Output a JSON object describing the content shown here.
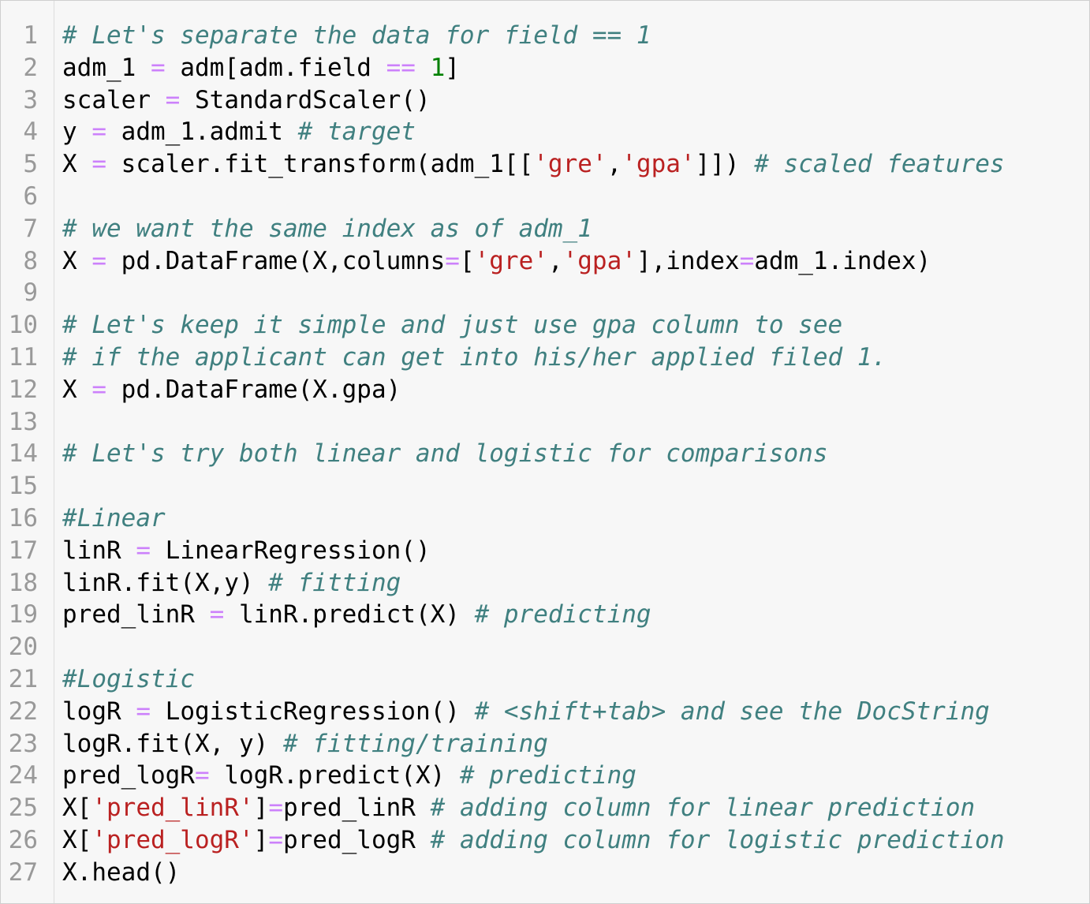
{
  "colors": {
    "background": "#f7f7f7",
    "line_number": "#999999",
    "comment": "#408080",
    "string": "#ba2121",
    "number": "#008000",
    "operator": "#aa22ff",
    "text": "#000000"
  },
  "lines": [
    {
      "n": "1",
      "tokens": [
        {
          "t": "# Let's separate the data for field == 1",
          "k": "comment"
        }
      ]
    },
    {
      "n": "2",
      "tokens": [
        {
          "t": "adm_1 ",
          "k": "text"
        },
        {
          "t": "=",
          "k": "op"
        },
        {
          "t": " adm[adm.field ",
          "k": "text"
        },
        {
          "t": "==",
          "k": "op"
        },
        {
          "t": " ",
          "k": "text"
        },
        {
          "t": "1",
          "k": "number"
        },
        {
          "t": "]",
          "k": "text"
        }
      ]
    },
    {
      "n": "3",
      "tokens": [
        {
          "t": "scaler ",
          "k": "text"
        },
        {
          "t": "=",
          "k": "op"
        },
        {
          "t": " StandardScaler()",
          "k": "text"
        }
      ]
    },
    {
      "n": "4",
      "tokens": [
        {
          "t": "y ",
          "k": "text"
        },
        {
          "t": "=",
          "k": "op"
        },
        {
          "t": " adm_1.admit ",
          "k": "text"
        },
        {
          "t": "# target",
          "k": "comment"
        }
      ]
    },
    {
      "n": "5",
      "tokens": [
        {
          "t": "X ",
          "k": "text"
        },
        {
          "t": "=",
          "k": "op"
        },
        {
          "t": " scaler.fit_transform(adm_1[[",
          "k": "text"
        },
        {
          "t": "'gre'",
          "k": "string"
        },
        {
          "t": ",",
          "k": "text"
        },
        {
          "t": "'gpa'",
          "k": "string"
        },
        {
          "t": "]]) ",
          "k": "text"
        },
        {
          "t": "# scaled features",
          "k": "comment"
        }
      ]
    },
    {
      "n": "6",
      "tokens": []
    },
    {
      "n": "7",
      "tokens": [
        {
          "t": "# we want the same index as of adm_1",
          "k": "comment"
        }
      ]
    },
    {
      "n": "8",
      "tokens": [
        {
          "t": "X ",
          "k": "text"
        },
        {
          "t": "=",
          "k": "op"
        },
        {
          "t": " pd.DataFrame(X,columns",
          "k": "text"
        },
        {
          "t": "=",
          "k": "op"
        },
        {
          "t": "[",
          "k": "text"
        },
        {
          "t": "'gre'",
          "k": "string"
        },
        {
          "t": ",",
          "k": "text"
        },
        {
          "t": "'gpa'",
          "k": "string"
        },
        {
          "t": "],index",
          "k": "text"
        },
        {
          "t": "=",
          "k": "op"
        },
        {
          "t": "adm_1.index)",
          "k": "text"
        }
      ]
    },
    {
      "n": "9",
      "tokens": []
    },
    {
      "n": "10",
      "tokens": [
        {
          "t": "# Let's keep it simple and just use gpa column to see",
          "k": "comment"
        }
      ]
    },
    {
      "n": "11",
      "tokens": [
        {
          "t": "# if the applicant can get into his/her applied filed 1.",
          "k": "comment"
        }
      ]
    },
    {
      "n": "12",
      "tokens": [
        {
          "t": "X ",
          "k": "text"
        },
        {
          "t": "=",
          "k": "op"
        },
        {
          "t": " pd.DataFrame(X.gpa)",
          "k": "text"
        }
      ]
    },
    {
      "n": "13",
      "tokens": []
    },
    {
      "n": "14",
      "tokens": [
        {
          "t": "# Let's try both linear and logistic for comparisons",
          "k": "comment"
        }
      ]
    },
    {
      "n": "15",
      "tokens": []
    },
    {
      "n": "16",
      "tokens": [
        {
          "t": "#Linear",
          "k": "comment"
        }
      ]
    },
    {
      "n": "17",
      "tokens": [
        {
          "t": "linR ",
          "k": "text"
        },
        {
          "t": "=",
          "k": "op"
        },
        {
          "t": " LinearRegression()",
          "k": "text"
        }
      ]
    },
    {
      "n": "18",
      "tokens": [
        {
          "t": "linR.fit(X,y) ",
          "k": "text"
        },
        {
          "t": "# fitting",
          "k": "comment"
        }
      ]
    },
    {
      "n": "19",
      "tokens": [
        {
          "t": "pred_linR ",
          "k": "text"
        },
        {
          "t": "=",
          "k": "op"
        },
        {
          "t": " linR.predict(X) ",
          "k": "text"
        },
        {
          "t": "# predicting",
          "k": "comment"
        }
      ]
    },
    {
      "n": "20",
      "tokens": []
    },
    {
      "n": "21",
      "tokens": [
        {
          "t": "#Logistic",
          "k": "comment"
        }
      ]
    },
    {
      "n": "22",
      "tokens": [
        {
          "t": "logR ",
          "k": "text"
        },
        {
          "t": "=",
          "k": "op"
        },
        {
          "t": " LogisticRegression() ",
          "k": "text"
        },
        {
          "t": "# <shift+tab> and see the DocString",
          "k": "comment"
        }
      ]
    },
    {
      "n": "23",
      "tokens": [
        {
          "t": "logR.fit(X, y) ",
          "k": "text"
        },
        {
          "t": "# fitting/training",
          "k": "comment"
        }
      ]
    },
    {
      "n": "24",
      "tokens": [
        {
          "t": "pred_logR",
          "k": "text"
        },
        {
          "t": "=",
          "k": "op"
        },
        {
          "t": " logR.predict(X) ",
          "k": "text"
        },
        {
          "t": "# predicting",
          "k": "comment"
        }
      ]
    },
    {
      "n": "25",
      "tokens": [
        {
          "t": "X[",
          "k": "text"
        },
        {
          "t": "'pred_linR'",
          "k": "string"
        },
        {
          "t": "]",
          "k": "text"
        },
        {
          "t": "=",
          "k": "op"
        },
        {
          "t": "pred_linR ",
          "k": "text"
        },
        {
          "t": "# adding column for linear prediction",
          "k": "comment"
        }
      ]
    },
    {
      "n": "26",
      "tokens": [
        {
          "t": "X[",
          "k": "text"
        },
        {
          "t": "'pred_logR'",
          "k": "string"
        },
        {
          "t": "]",
          "k": "text"
        },
        {
          "t": "=",
          "k": "op"
        },
        {
          "t": "pred_logR ",
          "k": "text"
        },
        {
          "t": "# adding column for logistic prediction",
          "k": "comment"
        }
      ]
    },
    {
      "n": "27",
      "tokens": [
        {
          "t": "X.head()",
          "k": "text"
        }
      ]
    }
  ]
}
